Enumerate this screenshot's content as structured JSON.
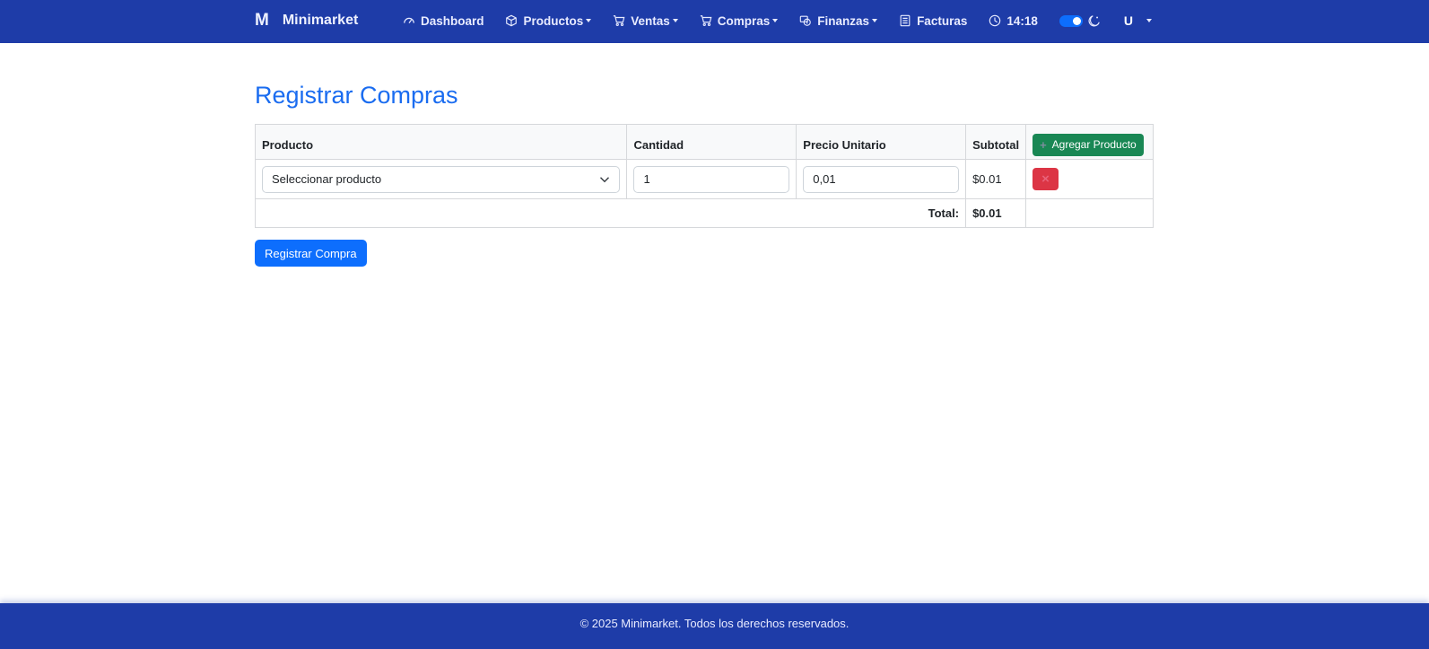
{
  "brand": {
    "logo": "M",
    "name": "Minimarket"
  },
  "nav": {
    "dashboard": "Dashboard",
    "productos": "Productos",
    "ventas": "Ventas",
    "compras": "Compras",
    "finanzas": "Finanzas",
    "facturas": "Facturas",
    "time": "14:18",
    "user": "U"
  },
  "page": {
    "title": "Registrar Compras"
  },
  "table": {
    "headers": {
      "producto": "Producto",
      "cantidad": "Cantidad",
      "precio": "Precio Unitario",
      "subtotal": "Subtotal"
    },
    "add_button": "Agregar Producto",
    "rows": [
      {
        "producto": "Seleccionar producto",
        "cantidad": "1",
        "precio": "0,01",
        "subtotal": "$0.01"
      }
    ],
    "total_label": "Total:",
    "total_value": "$0.01"
  },
  "submit_button": "Registrar Compra",
  "footer": {
    "text": "© 2025 Minimarket. Todos los derechos reservados."
  },
  "colors": {
    "navbar": "#1e3ca8",
    "title": "#1a6cf0",
    "primary": "#0d6efd",
    "success": "#198754",
    "danger": "#dc3545"
  }
}
